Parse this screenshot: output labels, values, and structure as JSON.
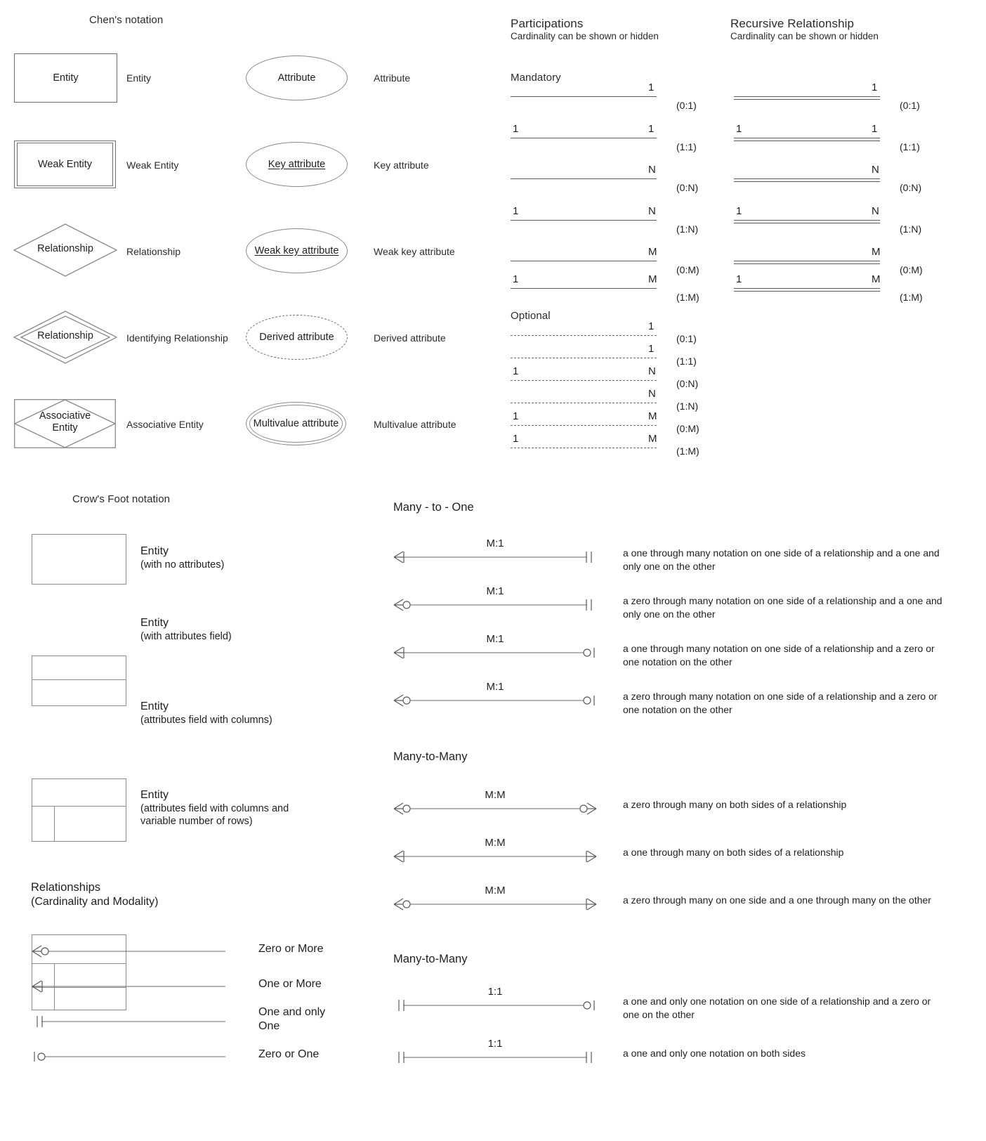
{
  "chen": {
    "title": "Chen's notation",
    "shapes": [
      {
        "shape_text": "Entity",
        "label": "Entity"
      },
      {
        "shape_text": "Weak Entity",
        "label": "Weak Entity"
      },
      {
        "shape_text": "Relationship",
        "label": "Relationship"
      },
      {
        "shape_text": "Relationship",
        "label": "Identifying Relationship"
      },
      {
        "shape_text": "Associative",
        "shape_text2": "Entity",
        "label": "Associative Entity"
      }
    ],
    "attributes": [
      {
        "shape_text": "Attribute",
        "label": "Attribute"
      },
      {
        "shape_text": "Key attribute",
        "label": "Key attribute"
      },
      {
        "shape_text": "Weak key attribute",
        "label": "Weak key attribute"
      },
      {
        "shape_text": "Derived attribute",
        "label": "Derived attribute"
      },
      {
        "shape_text": "Multivalue attribute",
        "label": "Multivalue attribute"
      }
    ]
  },
  "participations": {
    "title": "Participations",
    "subtitle": "Cardinality can be shown or hidden",
    "mandatory_label": "Mandatory",
    "optional_label": "Optional",
    "mandatory_rows": [
      {
        "left": "",
        "right": "1",
        "card": "(0:1)"
      },
      {
        "left": "1",
        "right": "1",
        "card": "(1:1)"
      },
      {
        "left": "",
        "right": "N",
        "card": "(0:N)"
      },
      {
        "left": "1",
        "right": "N",
        "card": "(1:N)"
      },
      {
        "left": "",
        "right": "M",
        "card": "(0:M)"
      },
      {
        "left": "1",
        "right": "M",
        "card": "(1:M)"
      }
    ],
    "optional_rows": [
      {
        "left": "",
        "right": "1",
        "card": "(0:1)"
      },
      {
        "left": "",
        "right": "1",
        "card": "(1:1)"
      },
      {
        "left": "1",
        "right": "N",
        "card": "(0:N)"
      },
      {
        "left": "",
        "right": "N",
        "card": "(1:N)"
      },
      {
        "left": "1",
        "right": "M",
        "card": "(0:M)"
      },
      {
        "left": "1",
        "right": "M",
        "card": "(1:M)"
      }
    ]
  },
  "recursive": {
    "title": "Recursive Relationship",
    "subtitle": "Cardinality can be shown or hidden",
    "rows": [
      {
        "left": "",
        "right": "1",
        "card": "(0:1)"
      },
      {
        "left": "1",
        "right": "1",
        "card": "(1:1)"
      },
      {
        "left": "",
        "right": "N",
        "card": "(0:N)"
      },
      {
        "left": "1",
        "right": "N",
        "card": "(1:N)"
      },
      {
        "left": "",
        "right": "M",
        "card": "(0:M)"
      },
      {
        "left": "1",
        "right": "M",
        "card": "(1:M)"
      }
    ]
  },
  "crowsfoot": {
    "title": "Crow's Foot notation",
    "entities": [
      {
        "name": "Entity",
        "sub": "(with no attributes)"
      },
      {
        "name": "Entity",
        "sub": "(with attributes field)"
      },
      {
        "name": "Entity",
        "sub": "(attributes field with columns)"
      },
      {
        "name": "Entity",
        "sub": "(attributes field with columns and",
        "sub2": "variable number of rows)"
      }
    ],
    "relationships_title": "Relationships",
    "relationships_sub": "(Cardinality and Modality)",
    "modality": [
      {
        "label": "Zero or More",
        "left_end": "zero-or-more"
      },
      {
        "label": "One or More",
        "left_end": "one-or-more"
      },
      {
        "label": "One and only",
        "label2": "One",
        "left_end": "one-and-only-one"
      },
      {
        "label": "Zero or One",
        "left_end": "zero-or-one"
      }
    ]
  },
  "many_to_one": {
    "title": "Many - to - One",
    "rows": [
      {
        "ratio": "M:1",
        "left_end": "one-or-more",
        "right_end": "one-and-only-one",
        "desc": "a one through many notation on one side of a relationship and a one and only one on the other"
      },
      {
        "ratio": "M:1",
        "left_end": "zero-or-more",
        "right_end": "one-and-only-one",
        "desc": "a zero through many notation on one side of a relationship and a one and only one on the other"
      },
      {
        "ratio": "M:1",
        "left_end": "one-or-more",
        "right_end": "zero-or-one",
        "desc": "a one through many notation on one side of a relationship and a zero or one notation on the other"
      },
      {
        "ratio": "M:1",
        "left_end": "zero-or-more",
        "right_end": "zero-or-one",
        "desc": "a zero through many notation on one side of a relationship and a zero or one notation on the other"
      }
    ]
  },
  "many_to_many": {
    "title": "Many-to-Many",
    "rows": [
      {
        "ratio": "M:M",
        "left_end": "zero-or-more",
        "right_end": "zero-or-more",
        "desc": "a zero through many on both sides of a relationship"
      },
      {
        "ratio": "M:M",
        "left_end": "one-or-more",
        "right_end": "one-or-more",
        "desc": "a one through many on both sides of a relationship"
      },
      {
        "ratio": "M:M",
        "left_end": "zero-or-more",
        "right_end": "one-or-more",
        "desc": "a zero through many on one side and a one through many on the other"
      }
    ]
  },
  "one_to_one": {
    "title": "Many-to-Many",
    "rows": [
      {
        "ratio": "1:1",
        "left_end": "one-and-only-one",
        "right_end": "zero-or-one",
        "desc": "a one and only one notation on one side of a relationship and a zero or one on the other"
      },
      {
        "ratio": "1:1",
        "left_end": "one-and-only-one",
        "right_end": "one-and-only-one",
        "desc": "a one and only one notation on both sides"
      }
    ]
  },
  "colors": {
    "line": "#5a5a5a",
    "shape_stroke": "#8a8a8a",
    "text": "#1f1f1f"
  }
}
